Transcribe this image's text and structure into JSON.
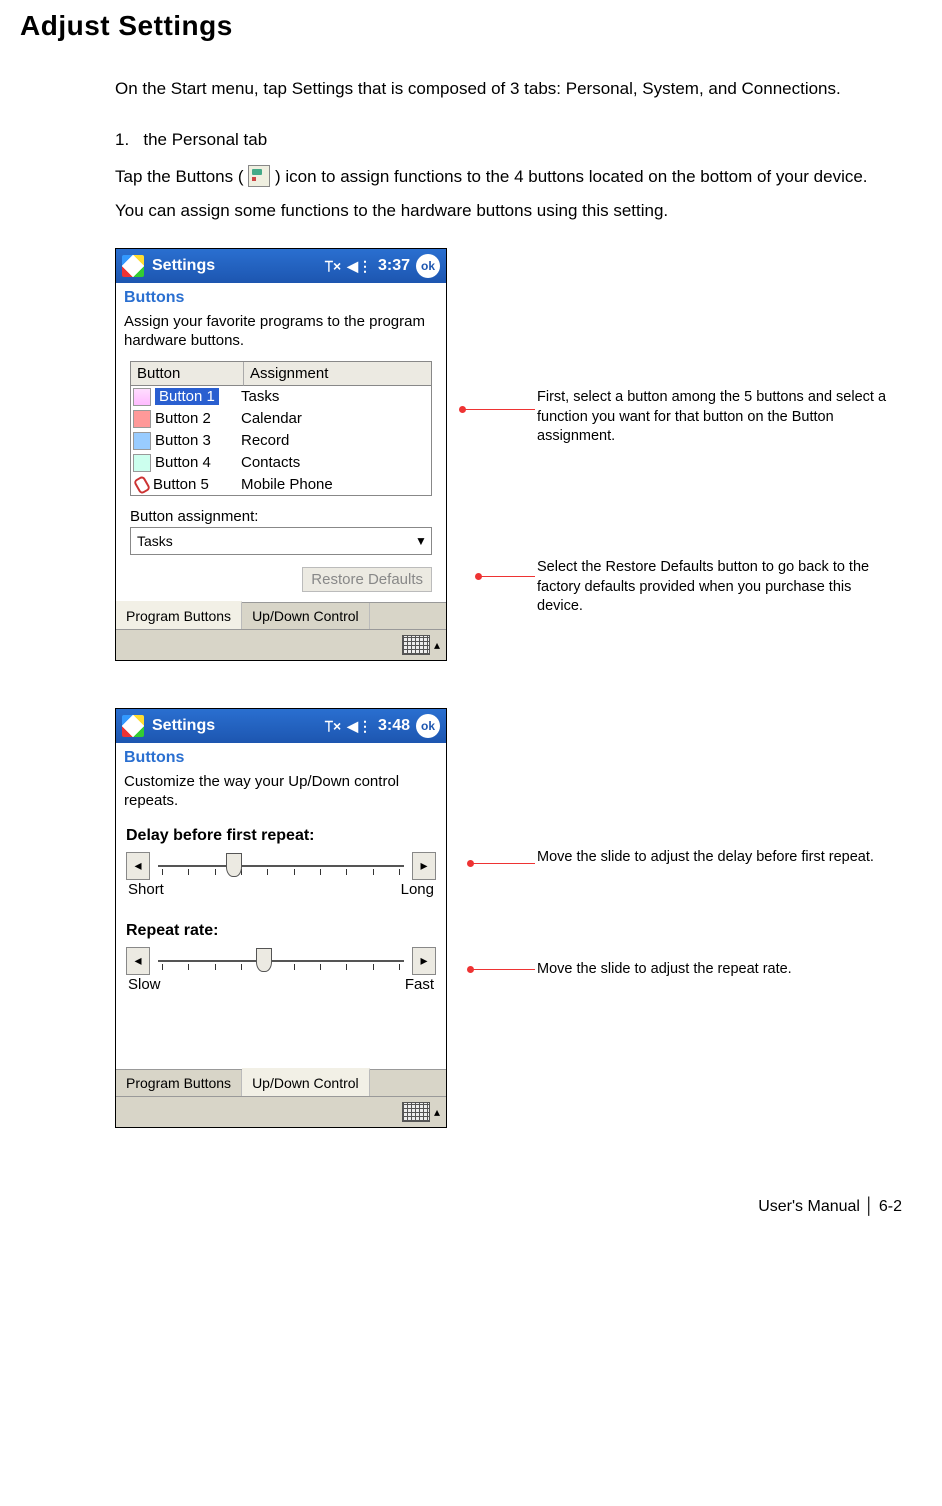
{
  "heading": "Adjust Settings",
  "intro": "On the Start menu, tap Settings that is composed of 3 tabs: Personal, System, and Connections.",
  "step_num": "1.",
  "step_title": "the Personal tab",
  "para2_a": "Tap the Buttons (",
  "para2_b": ") icon to assign functions to the 4 buttons located on the bottom of your device. You can assign some functions to the hardware buttons using this setting.",
  "shot1": {
    "title": "Settings",
    "time": "3:37",
    "ok": "ok",
    "subtitle": "Buttons",
    "desc": "Assign your favorite programs to the program hardware buttons.",
    "th_button": "Button",
    "th_assign": "Assignment",
    "rows": [
      {
        "btn": "Button 1",
        "assign": "Tasks",
        "icon": "task",
        "selected": true
      },
      {
        "btn": "Button 2",
        "assign": "Calendar",
        "icon": "cal"
      },
      {
        "btn": "Button 3",
        "assign": "Record",
        "icon": "rec"
      },
      {
        "btn": "Button 4",
        "assign": "Contacts",
        "icon": "con"
      },
      {
        "btn": "Button 5",
        "assign": "Mobile Phone",
        "icon": "phone"
      }
    ],
    "assign_label": "Button assignment:",
    "dropdown_value": "Tasks",
    "restore": "Restore Defaults",
    "tab1": "Program Buttons",
    "tab2": "Up/Down Control"
  },
  "callouts1": {
    "c1": "First, select a button among the 5 buttons and select a function you want for that button on the Button assignment.",
    "c2": "Select the Restore Defaults button to go back to the factory defaults provided when you purchase this device."
  },
  "shot2": {
    "title": "Settings",
    "time": "3:48",
    "ok": "ok",
    "subtitle": "Buttons",
    "desc": "Customize the way your Up/Down control repeats.",
    "label_delay": "Delay before first repeat:",
    "delay_left": "Short",
    "delay_right": "Long",
    "label_rate": "Repeat rate:",
    "rate_left": "Slow",
    "rate_right": "Fast",
    "tab1": "Program Buttons",
    "tab2": "Up/Down Control"
  },
  "callouts2": {
    "c1": "Move the slide to adjust the delay before first repeat.",
    "c2": "Move the slide to adjust the repeat rate."
  },
  "footer": "User's Manual │ 6-2"
}
